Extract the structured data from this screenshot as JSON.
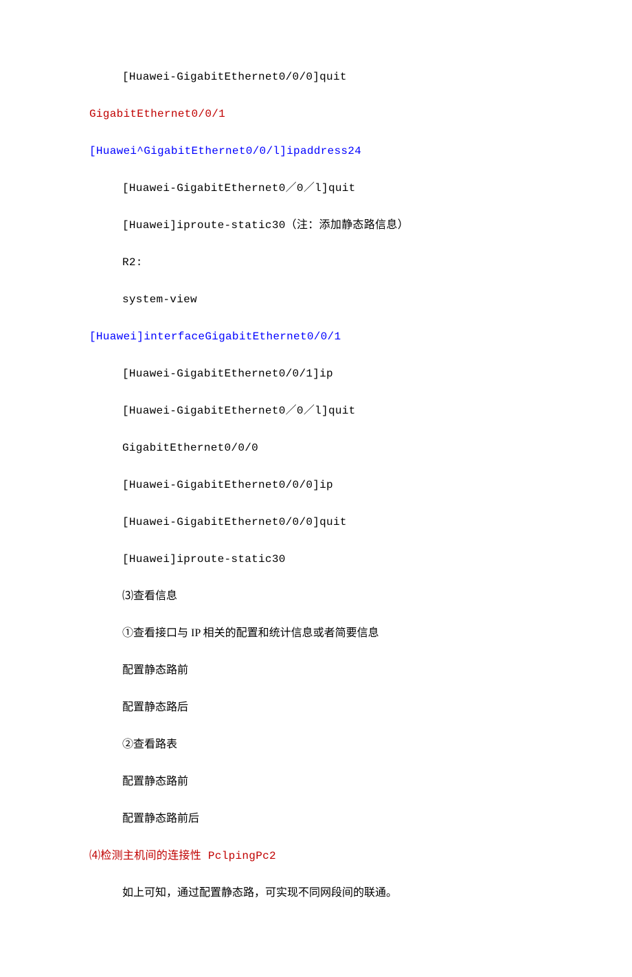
{
  "lines": [
    {
      "cls": "mono indent black",
      "text": "[Huawei-GigabitEthernet0/0/0]quit"
    },
    {
      "cls": "mono red",
      "text": "GigabitEthernet0/0/1"
    },
    {
      "cls": "mono blue",
      "text": "[Huawei^GigabitEthernet0/0/l]ipaddress24"
    },
    {
      "cls": "mono indent black",
      "text": "[Huawei-GigabitEthernet0／0／l]quit"
    },
    {
      "cls": "mono indent black",
      "text": "[Huawei]iproute-static30（注：添加静态路信息）"
    },
    {
      "cls": "mono indent black",
      "text": "R2:"
    },
    {
      "cls": "mono indent black",
      "text": "system-view"
    },
    {
      "cls": "mono blue",
      "text": "[Huawei]interfaceGigabitEthernet0/0/1"
    },
    {
      "cls": "mono indent black",
      "text": "[Huawei-GigabitEthernet0/0/1]ip"
    },
    {
      "cls": "mono indent black",
      "text": "[Huawei-GigabitEthernet0／0／l]quit"
    },
    {
      "cls": "mono indent black",
      "text": "GigabitEthernet0/0/0"
    },
    {
      "cls": "mono indent black",
      "text": "[Huawei-GigabitEthernet0/0/0]ip"
    },
    {
      "cls": "mono indent black",
      "text": "[Huawei-GigabitEthernet0/0/0]quit"
    },
    {
      "cls": "mono indent black",
      "text": "[Huawei]iproute-static30"
    },
    {
      "cls": "cjk indent black",
      "text": "⑶查看信息"
    },
    {
      "cls": "cjk indent black",
      "text": "①查看接口与 IP 相关的配置和统计信息或者简要信息"
    },
    {
      "cls": "cjk indent black",
      "text": "配置静态路前"
    },
    {
      "cls": "cjk indent black",
      "text": "配置静态路后"
    },
    {
      "cls": "cjk indent black",
      "text": "②查看路表"
    },
    {
      "cls": "cjk indent black",
      "text": "配置静态路前"
    },
    {
      "cls": "cjk indent black",
      "text": "配置静态路前后"
    },
    {
      "cls": "mono red",
      "text": "⑷检测主机间的连接性 PclpingPc2"
    },
    {
      "cls": "cjk indent black",
      "text": "如上可知，通过配置静态路，可实现不同网段间的联通。"
    }
  ]
}
